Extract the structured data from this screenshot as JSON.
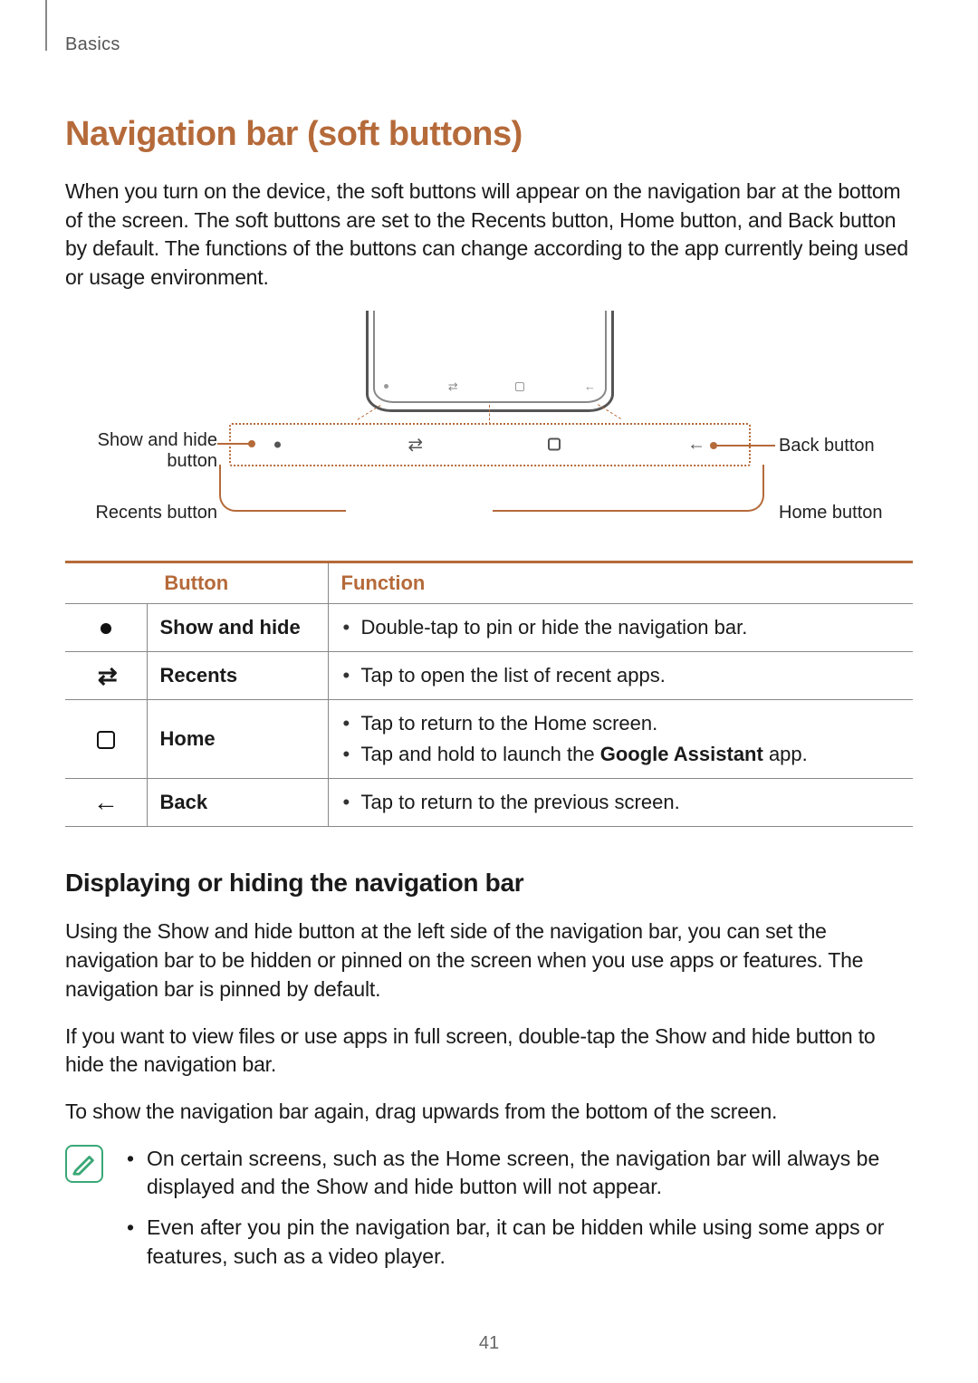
{
  "breadcrumb": "Basics",
  "heading": "Navigation bar (soft buttons)",
  "intro": "When you turn on the device, the soft buttons will appear on the navigation bar at the bottom of the screen. The soft buttons are set to the Recents button, Home button, and Back button by default. The functions of the buttons can change according to the app currently being used or usage environment.",
  "diagram": {
    "show_hide": "Show and hide button",
    "recents": "Recents button",
    "back": "Back button",
    "home": "Home button"
  },
  "table": {
    "head_button": "Button",
    "head_function": "Function",
    "rows": [
      {
        "icon": "dot",
        "name": "Show and hide",
        "fns": [
          "Double-tap to pin or hide the navigation bar."
        ]
      },
      {
        "icon": "sw",
        "name": "Recents",
        "fns": [
          "Tap to open the list of recent apps."
        ]
      },
      {
        "icon": "home",
        "name": "Home",
        "fns": [
          "Tap to return to the Home screen.",
          "Tap and hold to launch the <b>Google Assistant</b> app."
        ]
      },
      {
        "icon": "back",
        "name": "Back",
        "fns": [
          "Tap to return to the previous screen."
        ]
      }
    ]
  },
  "subheading": "Displaying or hiding the navigation bar",
  "sub_paras": [
    "Using the Show and hide button at the left side of the navigation bar, you can set the navigation bar to be hidden or pinned on the screen when you use apps or features. The navigation bar is pinned by default.",
    "If you want to view files or use apps in full screen, double-tap the Show and hide button to hide the navigation bar.",
    "To show the navigation bar again, drag upwards from the bottom of the screen."
  ],
  "note_items": [
    "On certain screens, such as the Home screen, the navigation bar will always be displayed and the Show and hide button will not appear.",
    "Even after you pin the navigation bar, it can be hidden while using some apps or features, such as a video player."
  ],
  "page_number": "41"
}
